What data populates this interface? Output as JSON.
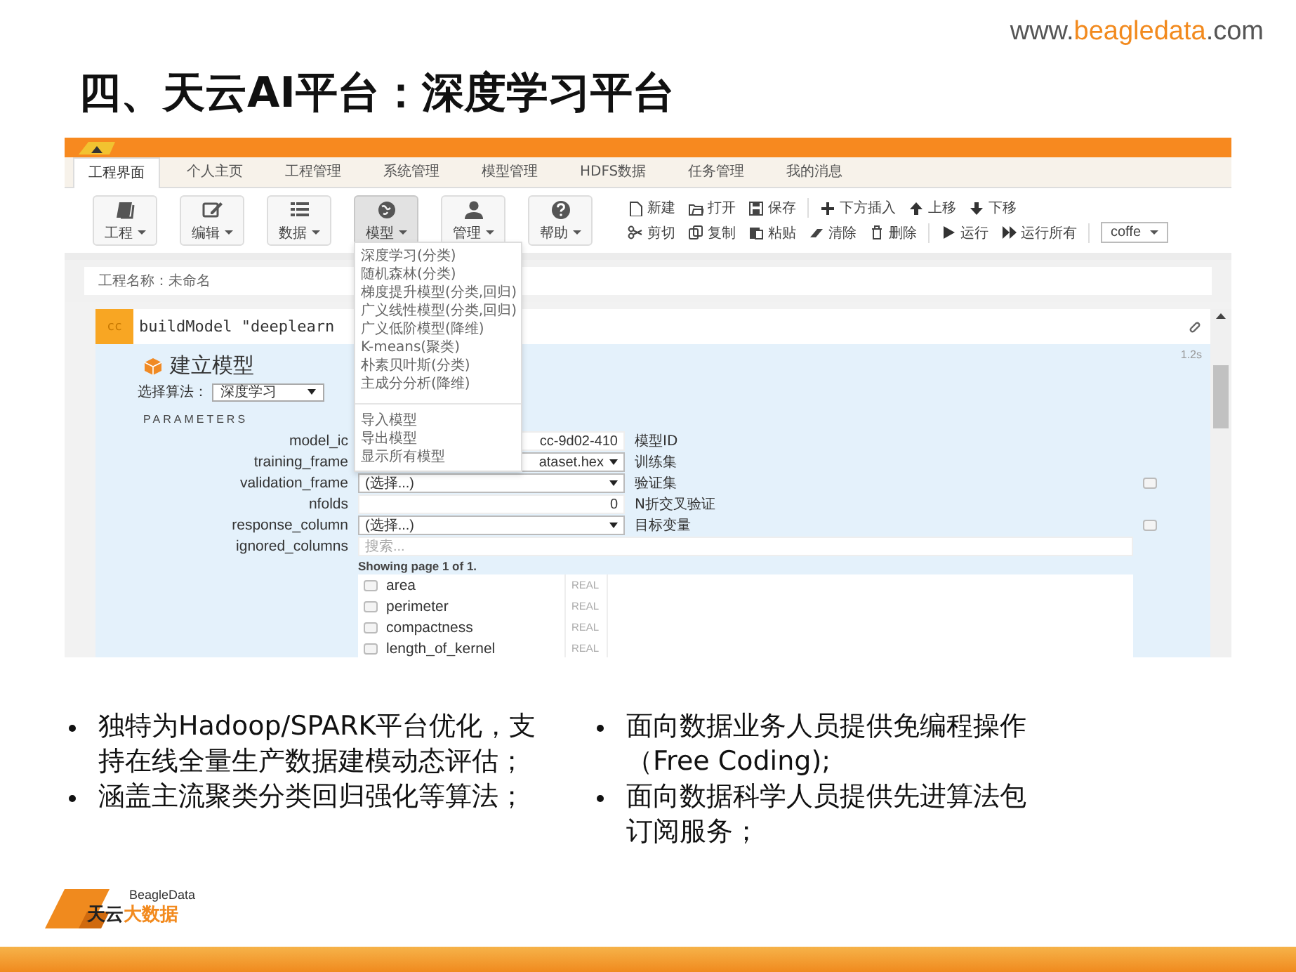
{
  "header": {
    "url_prefix": "www.",
    "url_brand": "beagledata",
    "url_suffix": ".com",
    "title": "四、天云AI平台：深度学习平台"
  },
  "app": {
    "tabs": [
      {
        "label": "工程界面",
        "selected": true
      },
      {
        "label": "个人主页",
        "selected": false
      },
      {
        "label": "工程管理",
        "selected": false
      },
      {
        "label": "系统管理",
        "selected": false
      },
      {
        "label": "模型管理",
        "selected": false
      },
      {
        "label": "HDFS数据",
        "selected": false
      },
      {
        "label": "任务管理",
        "selected": false
      },
      {
        "label": "我的消息",
        "selected": false
      }
    ],
    "toolbar": [
      {
        "label": "工程",
        "expanded": false
      },
      {
        "label": "编辑",
        "expanded": false
      },
      {
        "label": "数据",
        "expanded": false
      },
      {
        "label": "模型",
        "expanded": true
      },
      {
        "label": "管理",
        "expanded": false
      },
      {
        "label": "帮助",
        "expanded": false
      }
    ],
    "edit_rows": [
      {
        "groups": [
          [
            "新建",
            "打开",
            "保存"
          ],
          [
            "下方插入",
            "上移",
            "下移"
          ]
        ]
      },
      {
        "groups": [
          [
            "剪切",
            "复制",
            "粘贴",
            "清除",
            "删除"
          ],
          [
            "运行",
            "运行所有"
          ]
        ]
      }
    ],
    "kernel_select": "coffe",
    "project_name": "工程名称：未命名",
    "cell": {
      "prompt": "cc",
      "code": "buildModel \"deeplearn",
      "timing": "1.2s"
    },
    "form": {
      "heading": "建立模型",
      "algorithm_label": "选择算法：",
      "algorithm_value": "深度学习",
      "section": "PARAMETERS",
      "params": [
        {
          "kind": "text",
          "name": "model_ic",
          "value": "cc-9d02-410",
          "description": "模型ID"
        },
        {
          "kind": "select",
          "name": "training_frame",
          "value": "ataset.hex",
          "description": "训练集"
        },
        {
          "kind": "select",
          "name": "validation_frame",
          "value": "(选择...)",
          "description": "验证集",
          "checkbox": {
            "checked": false
          }
        },
        {
          "kind": "text",
          "name": "nfolds",
          "value": "0",
          "description": "N折交叉验证"
        },
        {
          "kind": "select",
          "name": "response_column",
          "value": "(选择...)",
          "description": "目标变量",
          "checkbox": {
            "checked": false
          }
        },
        {
          "kind": "search",
          "name": "ignored_columns",
          "placeholder": "搜索..."
        }
      ],
      "pager": "Showing page 1 of 1.",
      "columns": [
        {
          "name": "area",
          "type": "REAL",
          "checked": false
        },
        {
          "name": "perimeter",
          "type": "REAL",
          "checked": false
        },
        {
          "name": "compactness",
          "type": "REAL",
          "checked": false
        },
        {
          "name": "length_of_kernel",
          "type": "REAL",
          "checked": false
        }
      ]
    },
    "menu": {
      "groups": [
        [
          "深度学习(分类)",
          "随机森林(分类)",
          "梯度提升模型(分类,回归)",
          "广义线性模型(分类,回归)",
          "广义低阶模型(降维)",
          "K-means(聚类)",
          "朴素贝叶斯(分类)",
          "主成分分析(降维)"
        ],
        [
          "导入模型",
          "导出模型",
          "显示所有模型"
        ]
      ]
    }
  },
  "bullets": {
    "left": [
      "独特为Hadoop/SPARK平台优化，支持在线全量生产数据建模动态评估；",
      "涵盖主流聚类分类回归强化等算法；"
    ],
    "right": [
      "面向数据业务人员提供免编程操作（Free Coding);",
      "面向数据科学人员提供先进算法包订阅服务；"
    ]
  },
  "footer": {
    "brand": "BeagleData",
    "name_dark": "天云",
    "name_accent": "大数据"
  }
}
